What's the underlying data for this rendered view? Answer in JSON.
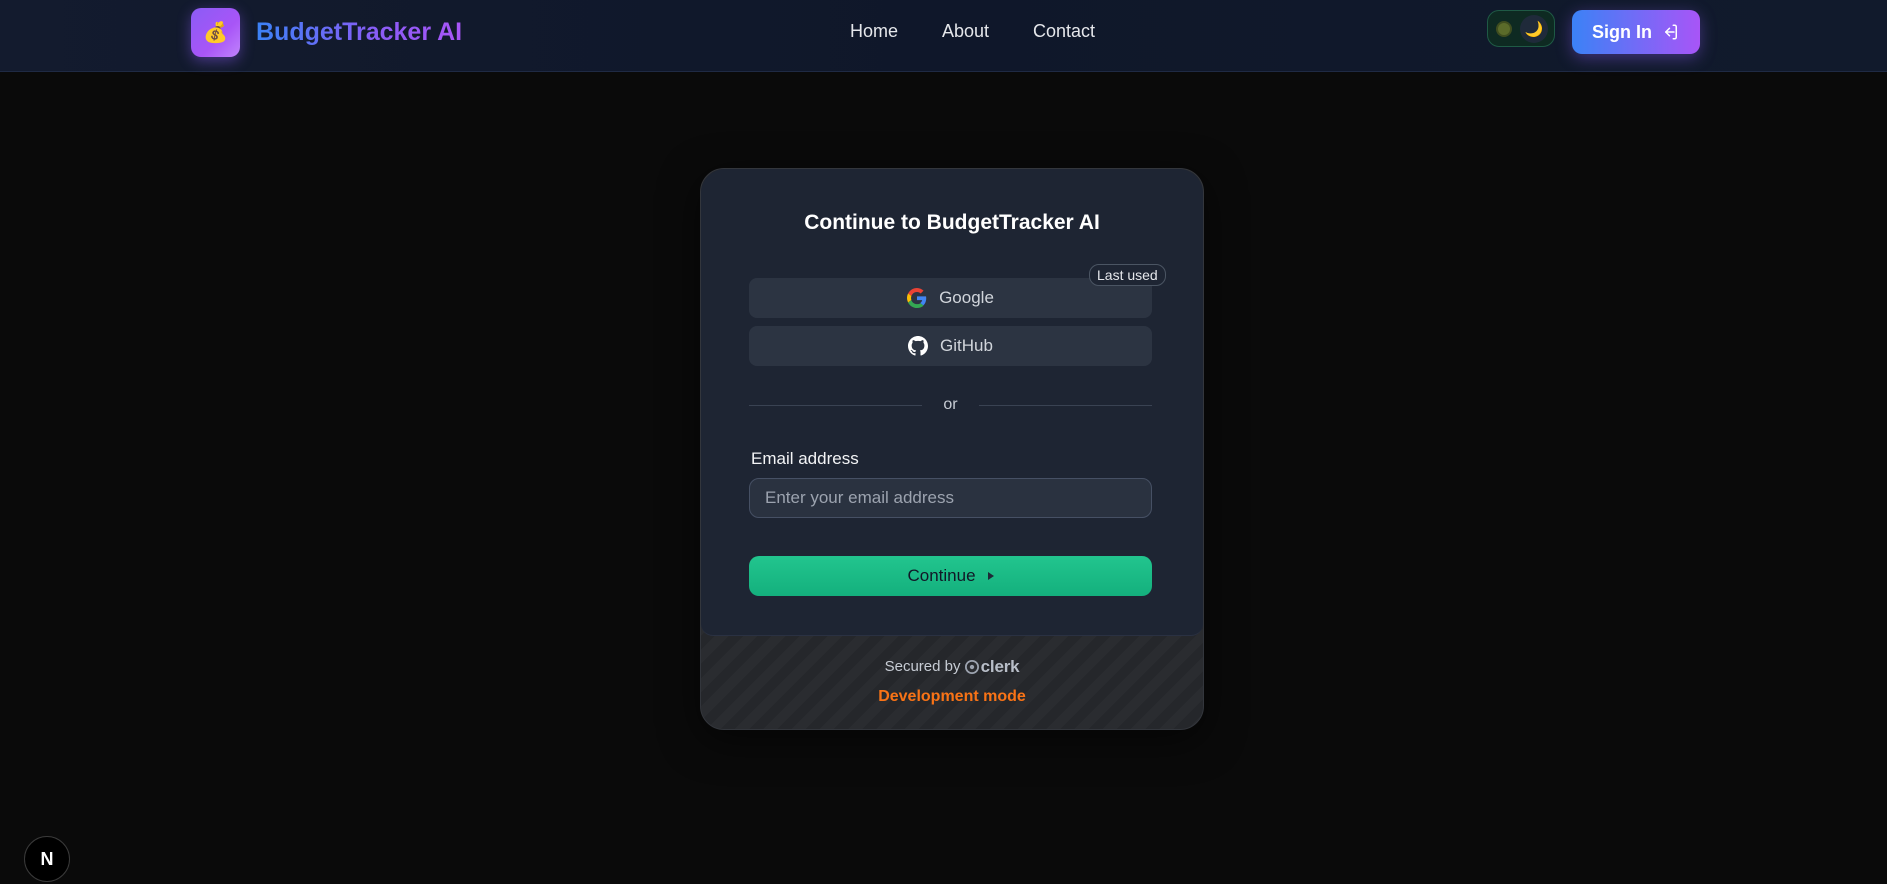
{
  "header": {
    "logo_emoji": "💰",
    "brand": "BudgetTracker AI",
    "nav": {
      "home": "Home",
      "about": "About",
      "contact": "Contact"
    },
    "theme_toggle": {
      "sun_icon": "sun-icon",
      "moon_icon": "🌙"
    },
    "signin_label": "Sign In"
  },
  "card": {
    "title": "Continue to BudgetTracker AI",
    "last_used_badge": "Last used",
    "google_label": "Google",
    "github_label": "GitHub",
    "divider_text": "or",
    "email_label": "Email address",
    "email_placeholder": "Enter your email address",
    "email_value": "",
    "continue_label": "Continue",
    "secured_prefix": "Secured by",
    "secured_brand": "clerk",
    "dev_mode": "Development mode"
  },
  "next_badge": "N",
  "colors": {
    "accent_gradient_start": "#3b82f6",
    "accent_gradient_end": "#a855f7",
    "continue_green": "#1fbf8a",
    "dev_mode_orange": "#f97316"
  }
}
